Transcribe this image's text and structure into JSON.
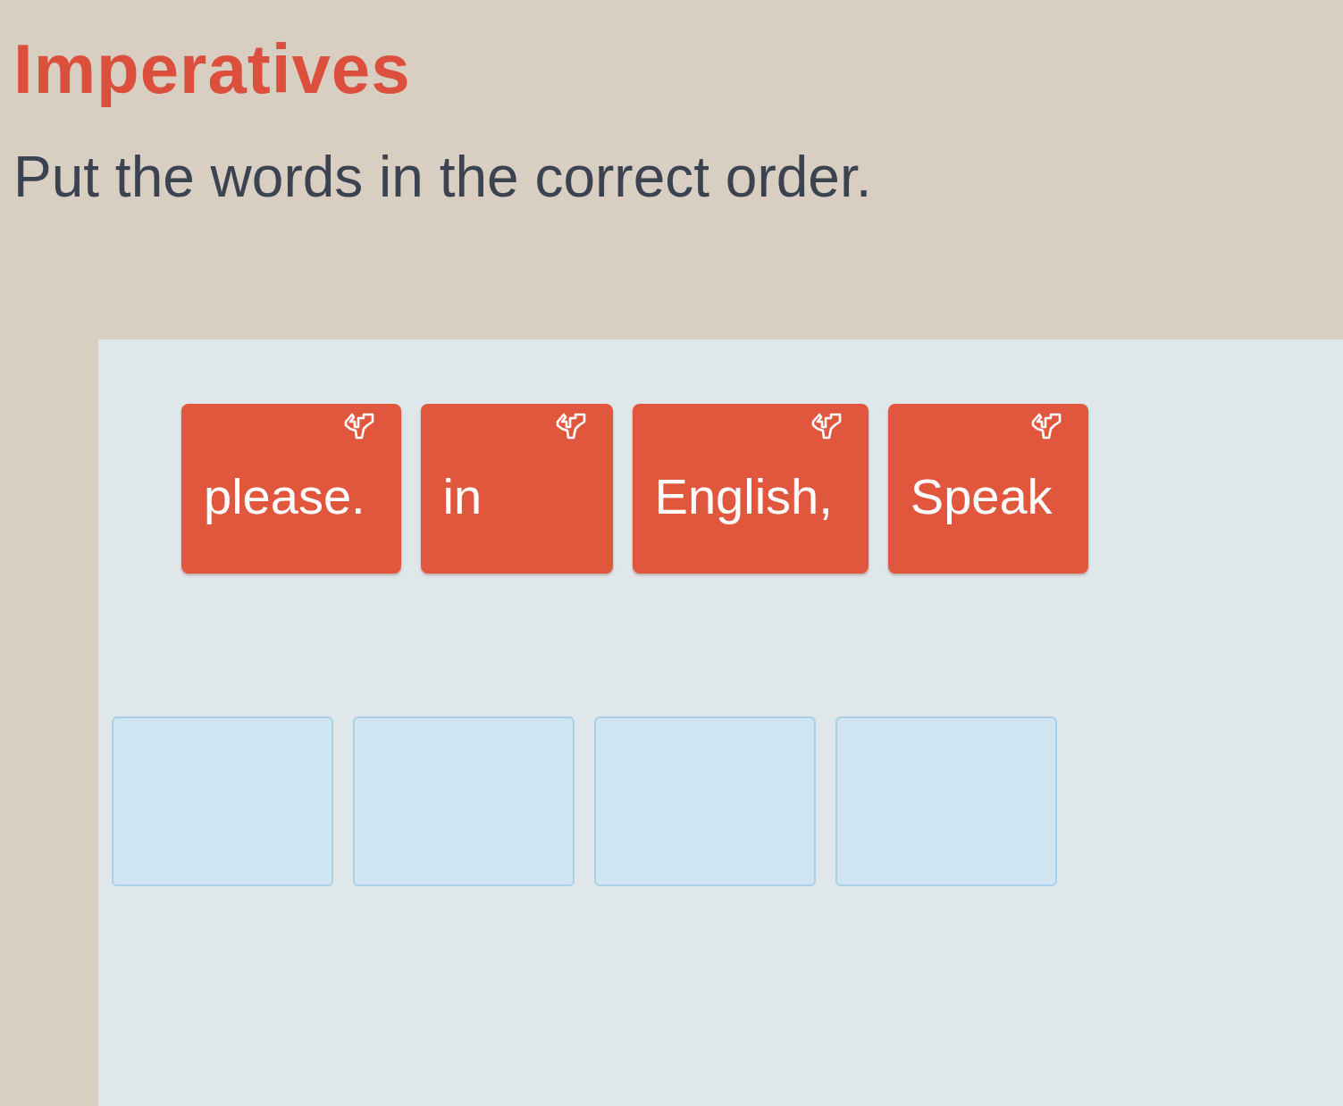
{
  "title": "Imperatives",
  "instruction": "Put the words in the correct order.",
  "word_tiles": [
    {
      "text": "please."
    },
    {
      "text": "in"
    },
    {
      "text": "English,"
    },
    {
      "text": "Speak"
    }
  ],
  "answer_slots": [
    {
      "kind": "blank"
    },
    {
      "kind": "blank"
    },
    {
      "kind": "blank"
    },
    {
      "kind": "blank"
    }
  ]
}
